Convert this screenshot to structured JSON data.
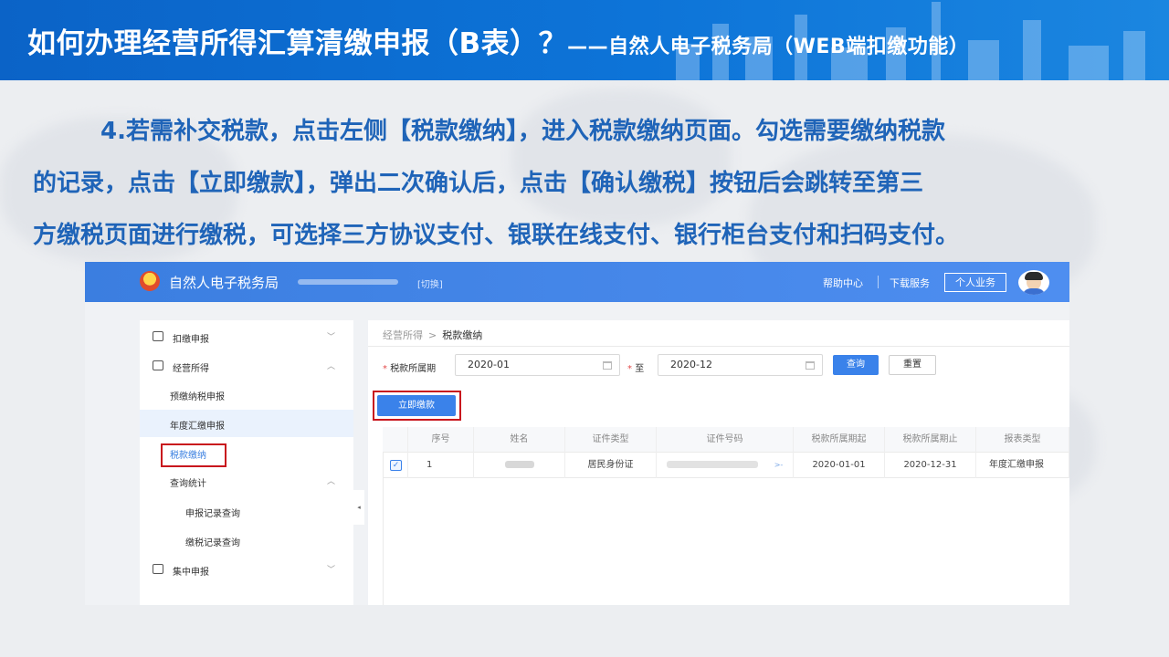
{
  "banner": {
    "title_main": "如何办理经营所得汇算清缴申报（B表）？",
    "title_sub": "——自然人电子税务局（WEB端扣缴功能）"
  },
  "instruction": {
    "line1": "4.若需补交税款，点击左侧【税款缴纳】，进入税款缴纳页面。勾选需要缴纳税款",
    "line2": "的记录，点击【立即缴款】，弹出二次确认后，点击【确认缴税】按钮后会跳转至第三",
    "line3": "方缴税页面进行缴税，可选择三方协议支付、银联在线支付、银行柜台支付和扫码支付。"
  },
  "app": {
    "name": "自然人电子税务局",
    "switch_label": "[切换]",
    "help": "帮助中心",
    "download": "下载服务",
    "personal": "个人业务"
  },
  "sidebar": {
    "items": [
      {
        "label": "扣缴申报",
        "chev": "﹀"
      },
      {
        "label": "经营所得",
        "chev": "︿"
      },
      {
        "label": "预缴纳税申报"
      },
      {
        "label": "年度汇缴申报"
      },
      {
        "label": "税款缴纳"
      },
      {
        "label": "查询统计",
        "chev": "︿"
      },
      {
        "label": "申报记录查询"
      },
      {
        "label": "缴税记录查询"
      },
      {
        "label": "集中申报",
        "chev": "﹀"
      }
    ]
  },
  "breadcrumb": {
    "parent": "经营所得",
    "separator": ">",
    "current": "税款缴纳"
  },
  "filter": {
    "required_mark": "*",
    "period_label": "税款所属期",
    "start": "2020-01",
    "to_label": "至",
    "end": "2020-12",
    "query": "查询",
    "reset": "重置"
  },
  "pay_now": "立即缴款",
  "table": {
    "headers": [
      "序号",
      "姓名",
      "证件类型",
      "证件号码",
      "税款所属期起",
      "税款所属期止",
      "报表类型"
    ],
    "rows": [
      {
        "index": "1",
        "id_type": "居民身份证",
        "start": "2020-01-01",
        "end": "2020-12-31",
        "report": "年度汇缴申报"
      }
    ]
  },
  "icons": {
    "checkbox": "✓",
    "collapse": "◂"
  },
  "colors": {
    "banner_blue": "#0d74d8",
    "instruction_blue": "#1f64b8",
    "app_header": "#4e8ef0",
    "primary": "#3a82ea",
    "highlight_red": "#c8161d"
  }
}
